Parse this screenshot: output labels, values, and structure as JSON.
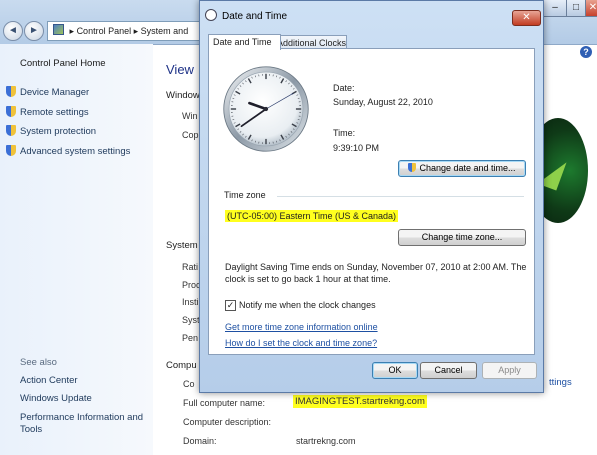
{
  "background_window": {
    "address_path": [
      "Control Panel",
      "System and"
    ],
    "nav_back": "◄",
    "nav_forward": "►",
    "help": "?",
    "control_minimize": "–",
    "control_maximize": "□",
    "control_close": "✕",
    "left_pane": {
      "home": "Control Panel Home",
      "tasks": [
        "Device Manager",
        "Remote settings",
        "System protection",
        "Advanced system settings"
      ],
      "see_also_heading": "See also",
      "see_also_links": [
        "Action Center",
        "Windows Update",
        "Performance Information and Tools"
      ]
    },
    "main": {
      "view_heading": "View",
      "windows_section_label": "Window",
      "windows_items": [
        "Win",
        "Cop"
      ],
      "system_section_label": "System",
      "system_items": [
        "Rati",
        "Proc",
        "Insti",
        "Syst",
        "Pen"
      ],
      "computer_section_label": "Compu",
      "computer_rows": [
        {
          "label": "Co",
          "value": ""
        },
        {
          "label": "Full computer name:",
          "value": "IMAGINGTEST.startrekng.com"
        },
        {
          "label": "Computer description:",
          "value": ""
        },
        {
          "label": "Domain:",
          "value": "startrekng.com"
        }
      ],
      "change_settings_link": "ttings"
    }
  },
  "dialog": {
    "title": "Date and Time",
    "close_glyph": "✕",
    "tabs": [
      {
        "label": "Date and Time",
        "active": true
      },
      {
        "label": "Additional Clocks",
        "active": false
      }
    ],
    "clock": {
      "hour": 9,
      "minute": 39,
      "second": 10
    },
    "date_label": "Date:",
    "date_value": "Sunday, August 22, 2010",
    "time_label": "Time:",
    "time_value": "9:39:10 PM",
    "change_date_button": "Change date and time...",
    "time_zone_heading": "Time zone",
    "time_zone_value": "(UTC-05:00) Eastern Time (US & Canada)",
    "highlight_color": "#ffff1f",
    "change_time_zone_button": "Change time zone...",
    "dst_message": "Daylight Saving Time ends on Sunday, November 07, 2010 at 2:00 AM. The clock is set to go back 1 hour at that time.",
    "notify_checkbox_checked": true,
    "notify_checkbox_label": "Notify me when the clock changes",
    "checkmark": "✓",
    "links": [
      "Get more time zone information online",
      "How do I set the clock and time zone?"
    ],
    "buttons": {
      "ok": "OK",
      "cancel": "Cancel",
      "apply": "Apply"
    }
  }
}
